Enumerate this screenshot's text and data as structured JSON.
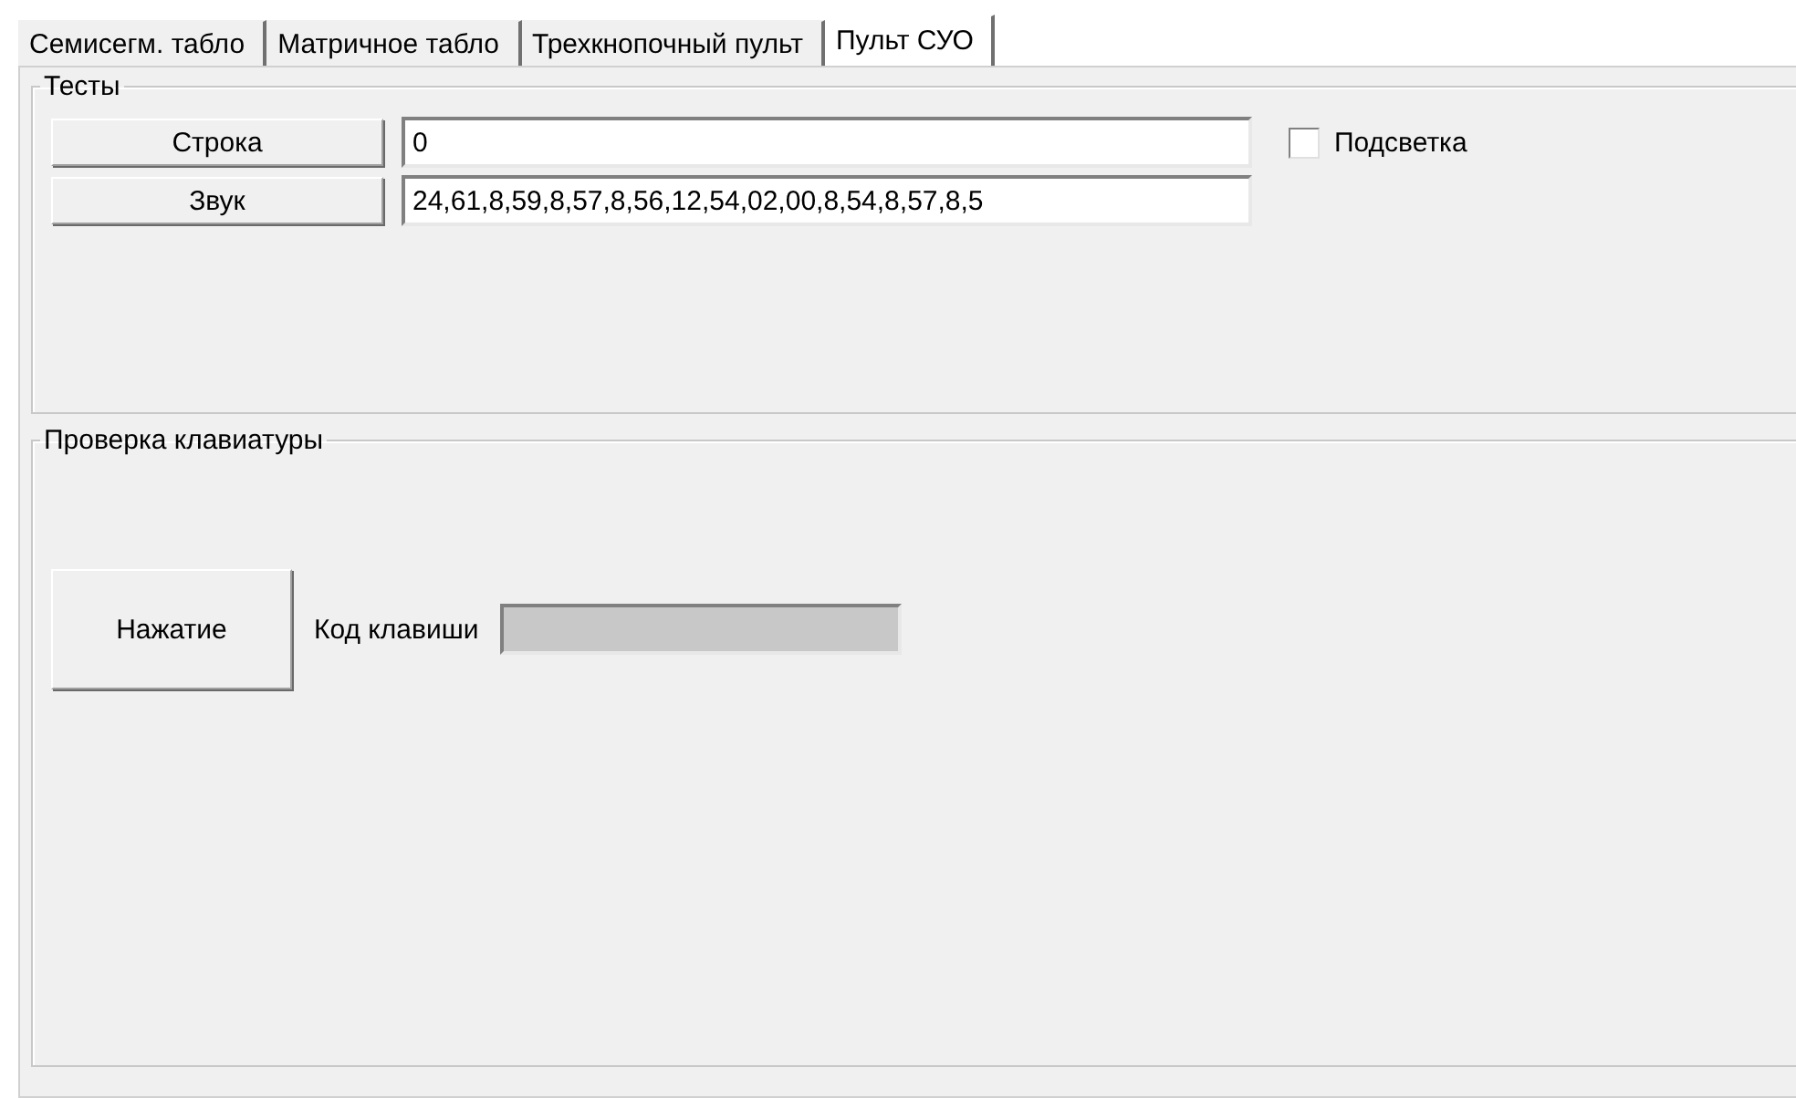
{
  "tabs": [
    {
      "label": "Семисегм. табло",
      "selected": false
    },
    {
      "label": "Матричное табло",
      "selected": false
    },
    {
      "label": "Трехкнопочный пульт",
      "selected": false
    },
    {
      "label": "Пульт СУО",
      "selected": true
    }
  ],
  "tests": {
    "title": "Тесты",
    "rows": [
      {
        "button": "Строка",
        "value": "0"
      },
      {
        "button": "Звук",
        "value": "24,61,8,59,8,57,8,56,12,54,02,00,8,54,8,57,8,5"
      }
    ],
    "backlight": {
      "label": "Подсветка",
      "checked": false
    }
  },
  "keyboard": {
    "title": "Проверка клавиатуры",
    "button": "Нажатие",
    "label": "Код клавиши",
    "field": {
      "disabled": true
    }
  }
}
